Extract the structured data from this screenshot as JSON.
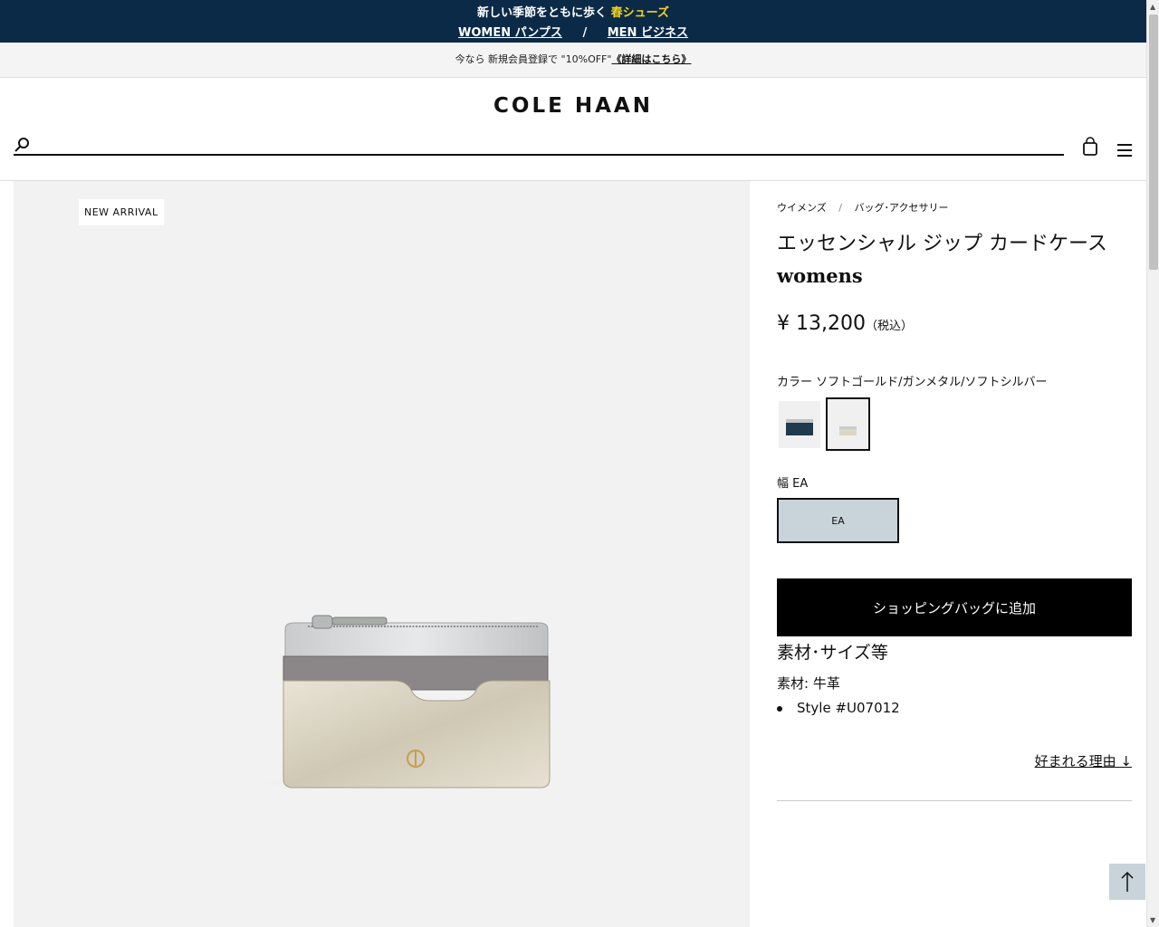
{
  "promo": {
    "line1_prefix": "新しい季節をともに歩く",
    "line1_highlight": "春シューズ",
    "link_women": "WOMEN パンプス",
    "separator": "/",
    "link_men": "MEN ビジネス",
    "bg_color": "#0b2a47",
    "highlight_color": "#f5d21a"
  },
  "subbar": {
    "text": "今なら 新規会員登録で \"10%OFF\"",
    "link": "《詳細はこちら》"
  },
  "header": {
    "logo": "COLE HAAN",
    "search_placeholder": ""
  },
  "gallery": {
    "badge": "NEW ARRIVAL"
  },
  "product": {
    "breadcrumb": [
      "ウイメンズ",
      "バッグ･アクセサリー"
    ],
    "breadcrumb_sep": "/",
    "title": "エッセンシャル ジップ カードケース",
    "subtitle": "womens",
    "price": "¥ 13,200",
    "tax_note": "（税込）",
    "color_label": "カラー ソフトゴールド/ガンメタル/ソフトシルバー",
    "width_label": "幅 EA",
    "size_option": "EA",
    "add_to_bag": "ショッピングバッグに追加",
    "spec_heading": "素材･サイズ等",
    "material": "素材: 牛革",
    "style": "Style #U07012",
    "reason_link": "好まれる理由 ↓"
  }
}
